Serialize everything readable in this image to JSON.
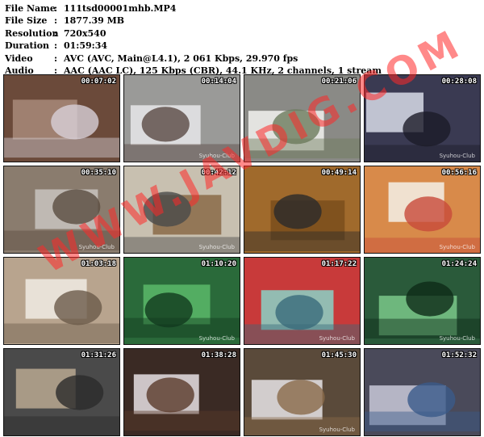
{
  "info": [
    {
      "key": "File Name",
      "value": "111tsd00001mhb.MP4"
    },
    {
      "key": "File Size",
      "value": "1877.39 MB"
    },
    {
      "key": "Resolution",
      "value": "720x540"
    },
    {
      "key": "Duration",
      "value": "01:59:34"
    },
    {
      "key": "Video",
      "value": "AVC (AVC, Main@L4.1), 2 061 Kbps, 29.970 fps"
    },
    {
      "key": "Audio",
      "value": "AAC (AAC LC), 125 Kbps (CBR), 44.1 KHz, 2 channels, 1 stream"
    }
  ],
  "separator": ":",
  "thumbnails": [
    {
      "time": "00:07:02",
      "brand": "",
      "colors": [
        "#6b4a3a",
        "#a88a7a",
        "#d8d0d8"
      ]
    },
    {
      "time": "00:14:04",
      "brand": "Syuhou-Club",
      "colors": [
        "#9a9a98",
        "#e8e8ea",
        "#5a4a44"
      ]
    },
    {
      "time": "00:21:06",
      "brand": "",
      "colors": [
        "#8a8a86",
        "#f2f2f0",
        "#6c7a5c"
      ]
    },
    {
      "time": "00:28:08",
      "brand": "Syuhou-Club",
      "colors": [
        "#3a3a52",
        "#d8dce8",
        "#1c1c28"
      ]
    },
    {
      "time": "00:35:10",
      "brand": "Syuhou-Club",
      "colors": [
        "#8a7c6e",
        "#c8c4c0",
        "#5a4c40"
      ]
    },
    {
      "time": "00:42:12",
      "brand": "Syuhou-Club",
      "colors": [
        "#c8c0b0",
        "#8a6a48",
        "#4a4a4a"
      ]
    },
    {
      "time": "00:49:14",
      "brand": "",
      "colors": [
        "#a06a2c",
        "#7a4e1c",
        "#2a2a2a"
      ]
    },
    {
      "time": "00:56:16",
      "brand": "Syuhou-Club",
      "colors": [
        "#d88a4a",
        "#f4f0e8",
        "#c84a3a"
      ]
    },
    {
      "time": "01:03:18",
      "brand": "",
      "colors": [
        "#b8a48e",
        "#f0ece4",
        "#6a5a4a"
      ]
    },
    {
      "time": "01:10:20",
      "brand": "Syuhou-Club",
      "colors": [
        "#2a6a3a",
        "#5ab86a",
        "#123a1e"
      ]
    },
    {
      "time": "01:17:22",
      "brand": "Syuhou-Club",
      "colors": [
        "#c83a3a",
        "#8ad4c8",
        "#3a6a7a"
      ]
    },
    {
      "time": "01:24:24",
      "brand": "Syuhou-Club",
      "colors": [
        "#2a5a3a",
        "#7ac88a",
        "#0e2a18"
      ]
    },
    {
      "time": "01:31:26",
      "brand": "",
      "colors": [
        "#4a4a4a",
        "#b8a890",
        "#2a2a2a"
      ]
    },
    {
      "time": "01:38:28",
      "brand": "",
      "colors": [
        "#3a2a24",
        "#e8e0e4",
        "#5a3a2a"
      ]
    },
    {
      "time": "01:45:30",
      "brand": "Syuhou-Club",
      "colors": [
        "#5a4a3a",
        "#e8e4e8",
        "#8a6a4a"
      ]
    },
    {
      "time": "01:52:32",
      "brand": "",
      "colors": [
        "#4a4a5a",
        "#c8c8d8",
        "#3a5a8a"
      ]
    }
  ],
  "watermark": "WWW.JAVDIG.COM"
}
